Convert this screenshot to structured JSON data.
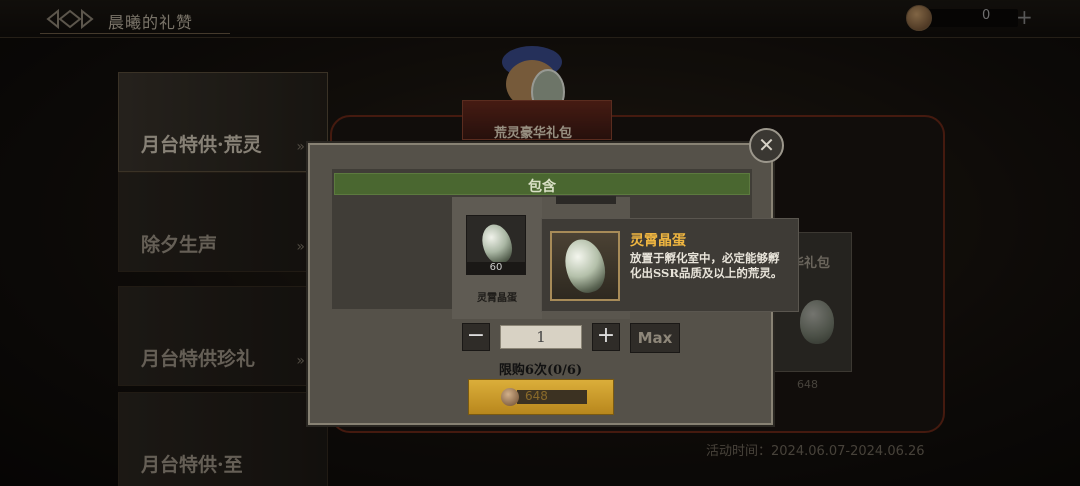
{
  "header": {
    "title": "晨曦的礼赞",
    "currency_value": "0",
    "currency_plus": "+"
  },
  "side_tabs": [
    {
      "label": "月台特供·荒灵",
      "chevron": "»"
    },
    {
      "label": "除夕生声",
      "chevron": "»"
    },
    {
      "label": "月台特供珍礼",
      "chevron": "»"
    },
    {
      "label": "月台特供·至",
      "chevron": ""
    }
  ],
  "gift": {
    "name": "荒灵豪华礼包",
    "bg_card_name": "奢华礼包",
    "bg_card_price": "648",
    "activity_time": "活动时间：2024.06.07-2024.06.26"
  },
  "modal": {
    "contains_label": "包含",
    "item": {
      "label": "灵霄晶蛋",
      "count": "60"
    },
    "quantity": "1",
    "minus": "−",
    "plus": "+",
    "max_label": "Max",
    "limit_text": "限购6次(0/6)",
    "price": "648",
    "close": "✕"
  },
  "tooltip": {
    "title": "灵霄晶蛋",
    "description": "放置于孵化室中，必定能够孵化出SSR品质及以上的荒灵。"
  },
  "colors": {
    "contains_bar": "#4a6730",
    "buy_button": "#dbae3a",
    "tooltip_title": "#f0b640"
  }
}
